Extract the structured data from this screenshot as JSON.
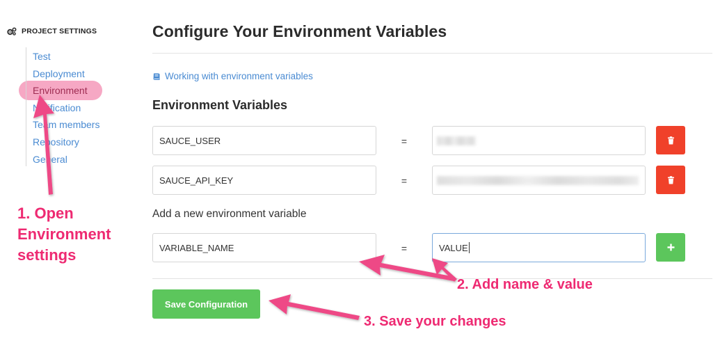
{
  "sidebar": {
    "heading": "PROJECT SETTINGS",
    "heading_icon": "gears-icon",
    "items": [
      {
        "label": "Test"
      },
      {
        "label": "Deployment"
      },
      {
        "label": "Environment",
        "active": true
      },
      {
        "label": "Notification"
      },
      {
        "label": "Team members"
      },
      {
        "label": "Repository"
      },
      {
        "label": "General"
      }
    ]
  },
  "main": {
    "title": "Configure Your Environment Variables",
    "doc_link": {
      "icon": "book-icon",
      "label": "Working with environment variables"
    },
    "section_title": "Environment Variables",
    "variables": [
      {
        "name": "SAUCE_USER",
        "equals": "=",
        "value_hidden": true
      },
      {
        "name": "SAUCE_API_KEY",
        "equals": "=",
        "value_hidden": true
      }
    ],
    "new_variable": {
      "title": "Add a new environment variable",
      "name": "VARIABLE_NAME",
      "equals": "=",
      "value": "VALUE"
    },
    "save_label": "Save Configuration"
  },
  "annotations": {
    "step1": [
      "1. Open",
      "Environment",
      "settings"
    ],
    "step2": "2. Add name & value",
    "step3": "3. Save your changes"
  },
  "colors": {
    "link": "#4a8bd2",
    "delete": "#f0412a",
    "add": "#5cc65c",
    "annotation": "#ee2a72",
    "highlight": "#f6a8c4"
  }
}
